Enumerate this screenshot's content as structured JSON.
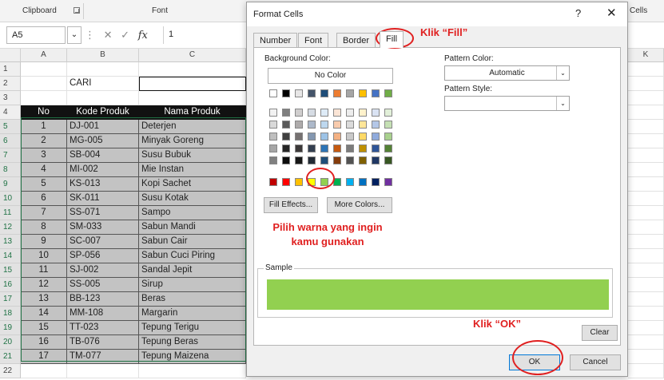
{
  "ribbon": {
    "clipboard": "Clipboard",
    "font": "Font",
    "cells": "Cells"
  },
  "formula_bar": {
    "name_box": "A5",
    "cancel_icon": "x-icon",
    "enter_icon": "check-icon",
    "fx": "fx",
    "value": "1"
  },
  "sheet": {
    "columns": [
      "A",
      "B",
      "C"
    ],
    "right_column": "K",
    "rows": [
      "1",
      "2",
      "3",
      "4",
      "5",
      "6",
      "7",
      "8",
      "9",
      "10",
      "11",
      "12",
      "13",
      "14",
      "15",
      "16",
      "17",
      "18",
      "19",
      "20",
      "21",
      "22"
    ],
    "search_label": "CARI",
    "headers": [
      "No",
      "Kode Produk",
      "Nama Produk"
    ],
    "data": [
      [
        "1",
        "DJ-001",
        "Deterjen"
      ],
      [
        "2",
        "MG-005",
        "Minyak Goreng"
      ],
      [
        "3",
        "SB-004",
        "Susu Bubuk"
      ],
      [
        "4",
        "MI-002",
        "Mie Instan"
      ],
      [
        "5",
        "KS-013",
        "Kopi Sachet"
      ],
      [
        "6",
        "SK-011",
        "Susu Kotak"
      ],
      [
        "7",
        "SS-071",
        "Sampo"
      ],
      [
        "8",
        "SM-033",
        "Sabun Mandi"
      ],
      [
        "9",
        "SC-007",
        "Sabun Cair"
      ],
      [
        "10",
        "SP-056",
        "Sabun Cuci Piring"
      ],
      [
        "11",
        "SJ-002",
        "Sandal Jepit"
      ],
      [
        "12",
        "SS-005",
        "Sirup"
      ],
      [
        "13",
        "BB-123",
        "Beras"
      ],
      [
        "14",
        "MM-108",
        "Margarin"
      ],
      [
        "15",
        "TT-023",
        "Tepung  Terigu"
      ],
      [
        "16",
        "TB-076",
        "Tepung Beras"
      ],
      [
        "17",
        "TM-077",
        "Tepung Maizena"
      ]
    ]
  },
  "dialog": {
    "title": "Format Cells",
    "help": "?",
    "close": "✕",
    "tabs": [
      "Number",
      "Font",
      "Border",
      "Fill"
    ],
    "active_tab": "Fill",
    "background_color_label": "Background Color:",
    "no_color": "No Color",
    "fill_effects": "Fill Effects...",
    "more_colors": "More Colors...",
    "pattern_color_label": "Pattern Color:",
    "pattern_color_value": "Automatic",
    "pattern_style_label": "Pattern Style:",
    "pattern_style_value": "",
    "sample_label": "Sample",
    "sample_color": "#92d050",
    "clear": "Clear",
    "ok": "OK",
    "cancel": "Cancel",
    "palette": {
      "theme_top": [
        "#ffffff",
        "#000000",
        "#e7e6e6",
        "#44546a",
        "#1f4e79",
        "#ed7d31",
        "#a5a5a5",
        "#ffc000",
        "#4472c4",
        "#70ad47"
      ],
      "tints": [
        [
          "#f2f2f2",
          "#7f7f7f",
          "#d0cece",
          "#d6dce4",
          "#deebf7",
          "#fbe5d6",
          "#ededed",
          "#fff2cc",
          "#dae3f3",
          "#e2f0d9"
        ],
        [
          "#d9d9d9",
          "#595959",
          "#aeabab",
          "#adb9ca",
          "#bdd7ee",
          "#f8cbad",
          "#dbdbdb",
          "#ffe699",
          "#b4c7e7",
          "#c5e0b4"
        ],
        [
          "#bfbfbf",
          "#404040",
          "#767171",
          "#8497b0",
          "#9dc3e6",
          "#f4b183",
          "#c9c9c9",
          "#ffd966",
          "#8faadc",
          "#a9d18e"
        ],
        [
          "#a6a6a6",
          "#262626",
          "#3b3838",
          "#333f50",
          "#2e75b6",
          "#c55a11",
          "#7b7b7b",
          "#bf9000",
          "#2f5597",
          "#548235"
        ],
        [
          "#808080",
          "#0d0d0d",
          "#171717",
          "#222a35",
          "#1f4e79",
          "#843c0c",
          "#525252",
          "#7f6000",
          "#203864",
          "#385723"
        ]
      ],
      "standard": [
        "#c00000",
        "#ff0000",
        "#ffc000",
        "#ffff00",
        "#92d050",
        "#00b050",
        "#00b0f0",
        "#0070c0",
        "#002060",
        "#7030a0"
      ]
    }
  },
  "annotations": {
    "fill": "Klik “Fill”",
    "pick": "Pilih warna yang ingin kamu gunakan",
    "ok": "Klik “OK”"
  }
}
